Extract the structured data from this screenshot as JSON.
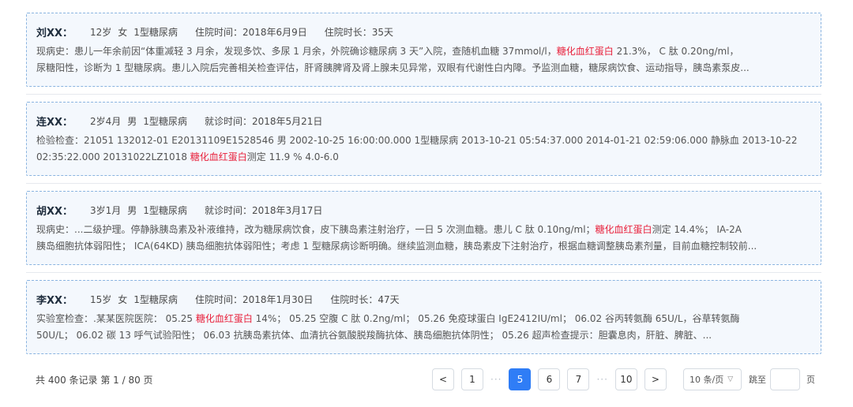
{
  "records": [
    {
      "name": "刘XX：",
      "age": "12岁",
      "gender": "女",
      "diagnosis": "1型糖尿病",
      "time": "住院时间：2018年6月9日",
      "duration": "住院时长：35天",
      "line1_a": "现病史：患儿一年余前因“体重减轻 3 月余，发现多饮、多尿 1 月余，外院确诊糖尿病 3 天”入院，查随机血糖 37mmol/l，",
      "line1_hl": "糖化血红蛋白",
      "line1_b": " 21.3%， C 肽 0.20ng/ml，",
      "line2_a": "尿糖阳性，诊断为 1 型糖尿病。患儿入院后完善相关检查评估，肝肾胰脾肾及肾上腺未见异常，双眼有代谢性白内障。予监测血糖，糖尿病饮食、运动指导，胰岛素泵皮...",
      "line2_hl": "",
      "line2_b": ""
    },
    {
      "name": "连XX：",
      "age": "2岁4月",
      "gender": "男",
      "diagnosis": "1型糖尿病",
      "time": "就诊时间：2018年5月21日",
      "duration": "",
      "line1_a": "检验检查：21051 132012-01 E20131109E1528546 男 2002-10-25 16:00:00.000 1型糖尿病 2013-10-21 05:54:37.000 2014-01-21 02:59:06.000 静脉血 2013-10-22",
      "line1_hl": "",
      "line1_b": "",
      "line2_a": "02:35:22.000 20131022LZ1018 ",
      "line2_hl": "糖化血红蛋白",
      "line2_b": "测定 11.9 % 4.0-6.0"
    },
    {
      "name": "胡XX：",
      "age": "3岁1月",
      "gender": "男",
      "diagnosis": "1型糖尿病",
      "time": "就诊时间：2018年3月17日",
      "duration": "",
      "line1_a": "现病史：...二级护理。停静脉胰岛素及补液维持，改为糖尿病饮食，皮下胰岛素注射治疗，一日 5 次测血糖。患儿 C 肽 0.10ng/ml；",
      "line1_hl": "糖化血红蛋白",
      "line1_b": "测定 14.4%； IA-2A",
      "line2_a": "胰岛细胞抗体弱阳性； ICA(64KD) 胰岛细胞抗体弱阳性；考虑 1 型糖尿病诊断明确。继续监测血糖，胰岛素皮下注射治疗，根据血糖调整胰岛素剂量，目前血糖控制较前...",
      "line2_hl": "",
      "line2_b": ""
    },
    {
      "name": "李XX：",
      "age": "15岁",
      "gender": "女",
      "diagnosis": "1型糖尿病",
      "time": "住院时间：2018年1月30日",
      "duration": "住院时长：47天",
      "line1_a": "实验室检查：.某某医院医院： 05.25 ",
      "line1_hl": "糖化血红蛋白",
      "line1_b": " 14%； 05.25 空腹 C 肽 0.2ng/ml； 05.26 免疫球蛋白 IgE2412IU/ml； 06.02 谷丙转氨酶 65U/L，谷草转氨酶",
      "line2_a": "50U/L； 06.02 碳 13 呼气试验阳性； 06.03 抗胰岛素抗体、血清抗谷氨酸脱羧酶抗体、胰岛细胞抗体阴性； 05.26 超声检查提示：胆囊息肉，肝脏、脾脏、...",
      "line2_hl": "",
      "line2_b": ""
    }
  ],
  "pagination": {
    "total": "共 400 条记录 第 1 / 80 页",
    "prev": "<",
    "next": ">",
    "dots": "···",
    "pages": [
      "1",
      "5",
      "6",
      "7",
      "10"
    ],
    "page_size": "10 条/页",
    "jump_label": "跳至",
    "page_unit": "页"
  },
  "colors": {
    "accent": "#2f7df6",
    "highlight": "#e8213c",
    "card_border": "#8ab4e0",
    "card_bg": "#f4f8fd"
  }
}
